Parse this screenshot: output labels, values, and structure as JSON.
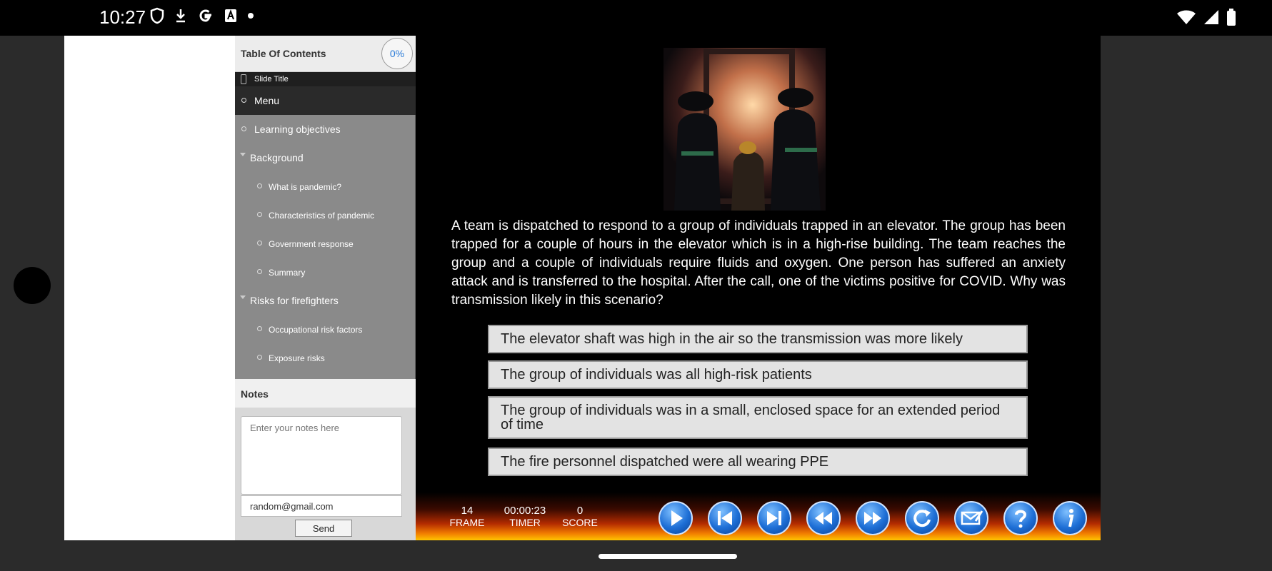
{
  "status_bar": {
    "time": "10:27"
  },
  "toc": {
    "title": "Table Of Contents",
    "progress": "0%",
    "slide_title": "Slide Title",
    "items": [
      {
        "label": "Menu",
        "level": 0,
        "active": true
      },
      {
        "label": "Learning objectives",
        "level": 0
      },
      {
        "label": "Background",
        "level": 0,
        "expanded": true
      },
      {
        "label": "What is pandemic?",
        "level": 1
      },
      {
        "label": "Characteristics of pandemic",
        "level": 1
      },
      {
        "label": "Government response",
        "level": 1
      },
      {
        "label": "Summary",
        "level": 1
      },
      {
        "label": "Risks for firefighters",
        "level": 0,
        "expanded": true
      },
      {
        "label": "Occupational risk factors",
        "level": 1
      },
      {
        "label": "Exposure risks",
        "level": 1
      }
    ]
  },
  "notes": {
    "title": "Notes",
    "placeholder": "Enter your notes here",
    "email": "random@gmail.com",
    "send_label": "Send"
  },
  "slide": {
    "question": "A team is dispatched to respond to a group of individuals trapped in an elevator. The group has been trapped for a couple of hours in the elevator which is in a high-rise building. The team reaches the group and a couple of individuals require fluids and oxygen. One person has suffered an anxiety attack and is transferred to the hospital. After the call, one of the victims positive for COVID. Why was transmission likely in this scenario?",
    "answers": [
      "The elevator shaft was high in the air so the transmission was more likely",
      "The group of individuals was all high-risk patients",
      "The group of individuals was in a small, enclosed space for an extended period of time",
      "The fire personnel dispatched were all wearing PPE"
    ]
  },
  "player": {
    "frame": {
      "value": "14",
      "label": "FRAME"
    },
    "timer": {
      "value": "00:00:23",
      "label": "TIMER"
    },
    "score": {
      "value": "0",
      "label": "SCORE"
    },
    "controls": [
      "play-icon",
      "skip-back-icon",
      "skip-forward-icon",
      "rewind-icon",
      "fast-forward-icon",
      "refresh-icon",
      "email-icon",
      "help-icon",
      "info-icon"
    ]
  },
  "colors": {
    "accent": "#2a7bd8",
    "stage": "#000000",
    "sidebar": "#8a8a8a"
  }
}
